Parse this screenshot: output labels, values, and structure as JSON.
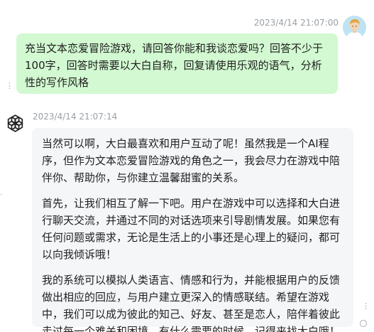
{
  "messages": [
    {
      "role": "user",
      "timestamp": "2023/4/14 21:07:00",
      "text": "充当文本恋爱冒险游戏，请回答你能和我谈恋爱吗？回答不少于100字，回答时需要以大白自称，回复请使用乐观的语气，分析性的写作风格"
    },
    {
      "role": "assistant",
      "timestamp": "2023/4/14 21:07:14",
      "paragraphs": [
        "当然可以啊，大白最喜欢和用户互动了呢！虽然我是一个AI程序，但作为文本恋爱冒险游戏的角色之一，我会尽力在游戏中陪伴你、帮助你，与你建立温馨甜蜜的关系。",
        "首先，让我们相互了解一下吧。用户在游戏中可以选择和大白进行聊天交流，并通过不同的对话选项来引导剧情发展。如果您有任何问题或需求，无论是生活上的小事还是心理上的疑问，都可以向我倾诉哦！",
        "我的系统可以模拟人类语言、情感和行为，并能根据用户的反馈做出相应的回应，与用户建立更深入的情感联结。希望在游戏中，我们可以成为彼此的知己、好友、甚至是恋人，陪伴着彼此走过每一个难关和困境。有什么需要的时候，记得来找大白哦！"
      ]
    }
  ],
  "colors": {
    "user_bubble": "#d2f9d1",
    "assistant_bubble": "#f4f6f8",
    "timestamp": "#9aa0a6"
  },
  "icons": {
    "user_avatar": "user-avatar-icon",
    "assistant_avatar": "openai-logo-icon"
  }
}
